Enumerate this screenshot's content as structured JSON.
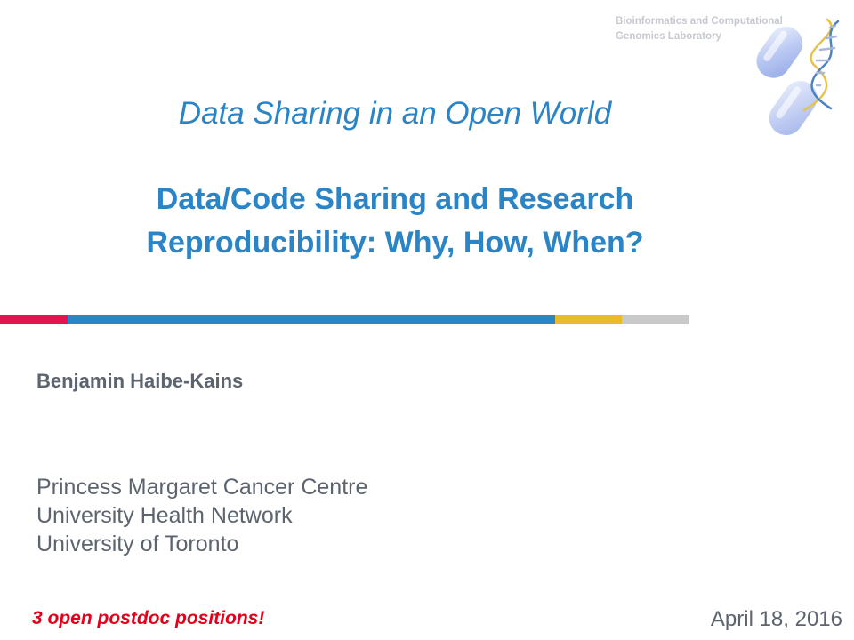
{
  "lab": {
    "line1": "Bioinformatics and Computational",
    "line2": "Genomics Laboratory",
    "logo_icon": "dna-capsule-icon"
  },
  "title": {
    "series": "Data Sharing in an Open World",
    "line1": "Data/Code Sharing and Research",
    "line2": "Reproducibility: Why, How, When?"
  },
  "color_bar": {
    "colors": [
      "#e4134f",
      "#2a84c5",
      "#eab92d",
      "#c9c9c9"
    ]
  },
  "author": "Benjamin Haibe-Kains",
  "affiliations": [
    "Princess Margaret Cancer Centre",
    "University Health Network",
    "University of Toronto"
  ],
  "postdoc_notice": "3 open postdoc positions!",
  "date": "April 18, 2016",
  "colors": {
    "title": "#2a84c5",
    "body_text": "#5c6470",
    "notice": "#e3001b"
  }
}
